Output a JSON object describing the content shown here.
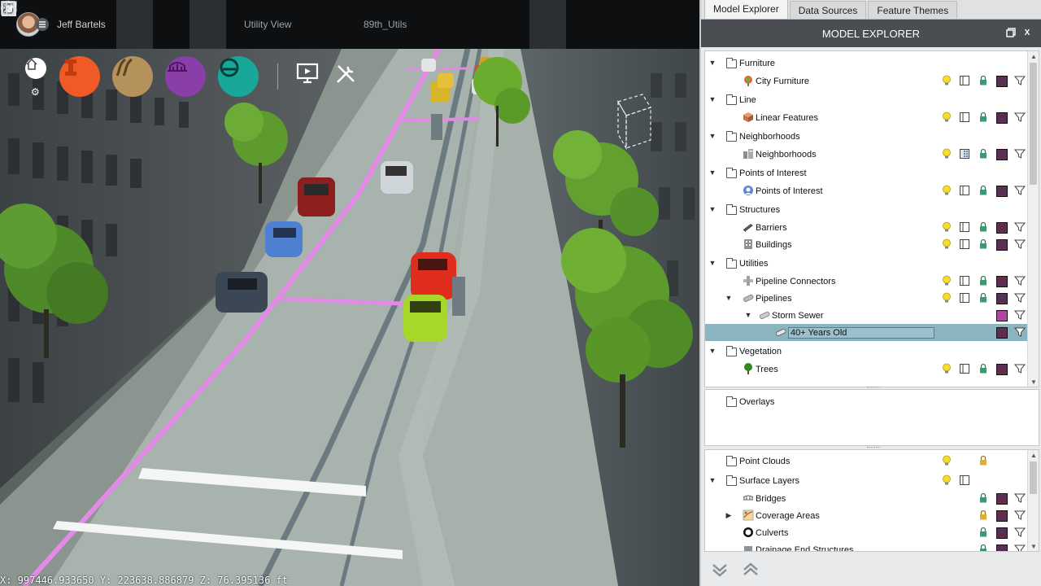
{
  "toolbar": {
    "user_name": "Jeff Bartels",
    "view_label": "Utility View",
    "project_label": "89th_Utils"
  },
  "colors": {
    "tool_orange": "#f05a24",
    "tool_tan": "#b5915c",
    "tool_purple": "#8a3fa8",
    "tool_teal": "#17a89a",
    "pipeline_pink": "#e38ae6",
    "panel_header": "#4a4e52",
    "layer_swatch": "#5a2f52",
    "layer_swatch_bright": "#b246a0",
    "selection": "#8ab4c0"
  },
  "status": {
    "coordinates": "X: 997446.933650  Y: 223638.886879  Z: 76.395136 ft"
  },
  "panel": {
    "tabs": [
      {
        "label": "Model Explorer",
        "active": true
      },
      {
        "label": "Data Sources",
        "active": false
      },
      {
        "label": "Feature Themes",
        "active": false
      }
    ],
    "title": "MODEL EXPLORER",
    "close_label": "X",
    "tree": [
      {
        "label": "Furniture",
        "level": 0,
        "kind": "folder",
        "expanded": true
      },
      {
        "label": "City Furniture",
        "level": 1,
        "kind": "layer",
        "icon": "city-furniture-icon",
        "controls": [
          "bulb",
          "book",
          "lock",
          "swatch",
          "filter"
        ]
      },
      {
        "label": "Line",
        "level": 0,
        "kind": "folder",
        "expanded": true
      },
      {
        "label": "Linear Features",
        "level": 1,
        "kind": "layer",
        "icon": "linear-features-icon",
        "controls": [
          "bulb",
          "book",
          "lock",
          "swatch",
          "filter"
        ]
      },
      {
        "label": "Neighborhoods",
        "level": 0,
        "kind": "folder",
        "expanded": true
      },
      {
        "label": "Neighborhoods",
        "level": 1,
        "kind": "layer",
        "icon": "neighborhoods-icon",
        "controls": [
          "bulb",
          "book-grid",
          "lock",
          "swatch",
          "filter"
        ]
      },
      {
        "label": "Points of Interest",
        "level": 0,
        "kind": "folder",
        "expanded": true
      },
      {
        "label": "Points of Interest",
        "level": 1,
        "kind": "layer",
        "icon": "poi-icon",
        "controls": [
          "bulb",
          "book",
          "lock",
          "swatch",
          "filter"
        ]
      },
      {
        "label": "Structures",
        "level": 0,
        "kind": "folder",
        "expanded": true
      },
      {
        "label": "Barriers",
        "level": 1,
        "kind": "layer",
        "icon": "barriers-icon",
        "controls": [
          "bulb",
          "book",
          "lock",
          "swatch",
          "filter"
        ]
      },
      {
        "label": "Buildings",
        "level": 1,
        "kind": "layer",
        "icon": "buildings-icon",
        "controls": [
          "bulb",
          "book",
          "lock",
          "swatch",
          "filter"
        ]
      },
      {
        "label": "Utilities",
        "level": 0,
        "kind": "folder",
        "expanded": true
      },
      {
        "label": "Pipeline Connectors",
        "level": 1,
        "kind": "layer",
        "icon": "pipeline-connectors-icon",
        "controls": [
          "bulb",
          "book",
          "lock",
          "swatch",
          "filter"
        ]
      },
      {
        "label": "Pipelines",
        "level": 1,
        "kind": "layer",
        "icon": "pipelines-icon",
        "expanded": true,
        "controls": [
          "bulb",
          "book",
          "lock",
          "swatch",
          "filter"
        ]
      },
      {
        "label": "Storm Sewer",
        "level": 2,
        "kind": "layer",
        "icon": "storm-sewer-icon",
        "expanded": true,
        "controls": [
          "swatch-bright",
          "filter"
        ]
      },
      {
        "label": "40+ Years Old",
        "level": 3,
        "kind": "layer",
        "icon": "pipe-segment-icon",
        "selected": true,
        "controls": [
          "swatch",
          "filter"
        ]
      },
      {
        "label": "Vegetation",
        "level": 0,
        "kind": "folder",
        "expanded": true
      },
      {
        "label": "Trees",
        "level": 1,
        "kind": "layer",
        "icon": "trees-icon",
        "controls": [
          "bulb",
          "book",
          "lock",
          "swatch",
          "filter"
        ]
      }
    ],
    "overlays": [
      {
        "label": "Overlays",
        "kind": "folder"
      }
    ],
    "tree_bottom": [
      {
        "label": "Point Clouds",
        "level": 0,
        "kind": "folder",
        "controls": [
          "bulb",
          "lock-gold"
        ]
      },
      {
        "label": "Surface Layers",
        "level": 0,
        "kind": "folder",
        "expanded": true,
        "controls": [
          "bulb",
          "book"
        ]
      },
      {
        "label": "Bridges",
        "level": 1,
        "kind": "layer",
        "icon": "bridges-icon",
        "controls": [
          "lock",
          "swatch",
          "filter"
        ]
      },
      {
        "label": "Coverage Areas",
        "level": 1,
        "kind": "layer",
        "icon": "coverage-areas-icon",
        "collapsed": true,
        "controls": [
          "lock-gold",
          "swatch",
          "filter"
        ]
      },
      {
        "label": "Culverts",
        "level": 1,
        "kind": "layer",
        "icon": "culverts-icon",
        "controls": [
          "lock",
          "swatch",
          "filter"
        ]
      },
      {
        "label": "Drainage End Structures",
        "level": 1,
        "kind": "layer",
        "icon": "drainage-icon",
        "controls": [
          "lock",
          "swatch",
          "filter"
        ]
      }
    ]
  }
}
